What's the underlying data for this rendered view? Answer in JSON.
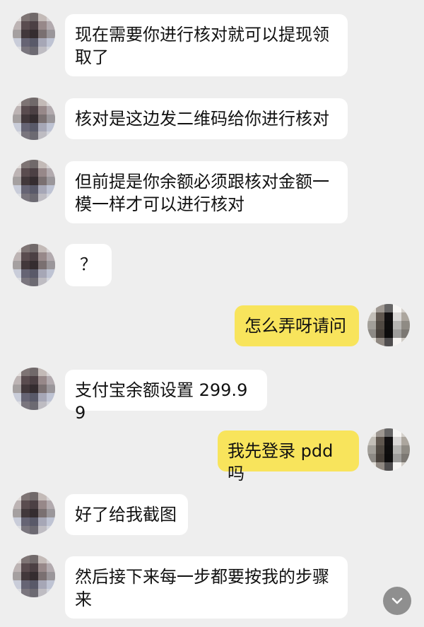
{
  "messages": [
    {
      "side": "left",
      "text": "现在需要你进行核对就可以提现领取了"
    },
    {
      "side": "left",
      "text": "核对是这边发二维码给你进行核对"
    },
    {
      "side": "left",
      "text": "但前提是你余额必须跟核对金额一模一样才可以进行核对"
    },
    {
      "side": "left",
      "text": "？"
    },
    {
      "side": "right",
      "text": "怎么弄呀请问"
    },
    {
      "side": "left",
      "text": "支付宝余额设置 299.99"
    },
    {
      "side": "right",
      "text": "我先登录 pdd 吗"
    },
    {
      "side": "left",
      "text": "好了给我截图"
    },
    {
      "side": "left",
      "text": "然后接下来每一步都要按我的步骤来"
    }
  ],
  "colors": {
    "background": "#eeeeee",
    "incoming_bubble": "#ffffff",
    "outgoing_bubble": "#f8e45c",
    "scroll_button": "#8f8f8f"
  },
  "icons": {
    "scroll_down": "chevron-down-icon"
  }
}
